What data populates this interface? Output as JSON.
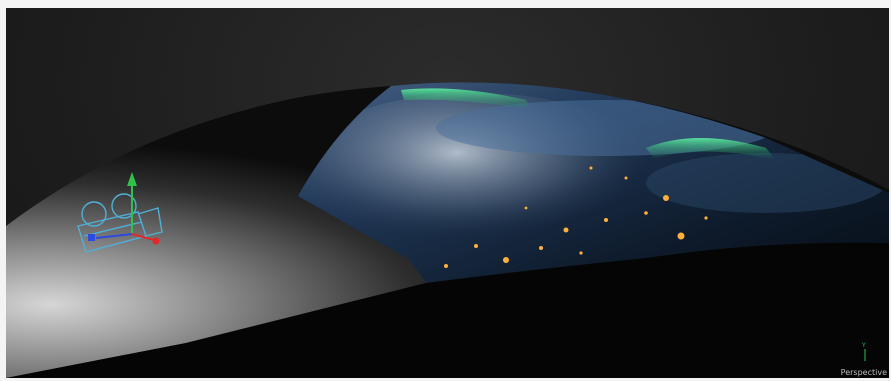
{
  "viewport": {
    "view_label": "Perspective",
    "gizmo_axis_label": "Y"
  },
  "colors": {
    "background": "#1d1d1d",
    "dome_light": "#cfcfcf",
    "camera_wire": "#4fb0d8",
    "axis_y": "#2ec24a",
    "axis_x": "#e02a2a",
    "axis_z": "#2a4ae0",
    "aurora": "#35e08a"
  },
  "icons": {
    "camera": "camera-icon",
    "gizmo": "axis-gizmo-icon"
  }
}
